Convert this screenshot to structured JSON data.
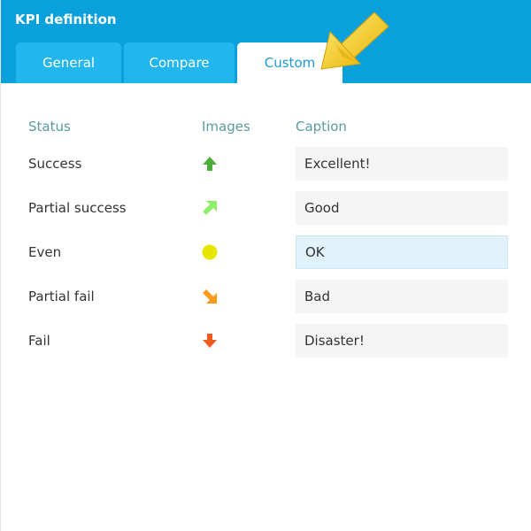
{
  "dialog": {
    "title": "KPI definition"
  },
  "tabs": [
    {
      "label": "General"
    },
    {
      "label": "Compare"
    },
    {
      "label": "Custom"
    }
  ],
  "active_tab": "Custom",
  "columns": {
    "status": "Status",
    "images": "Images",
    "caption": "Caption"
  },
  "rows": [
    {
      "status": "Success",
      "icon": "arrow-up-icon",
      "icon_color": "#4caf3c",
      "caption": "Excellent!"
    },
    {
      "status": "Partial success",
      "icon": "arrow-up-right-icon",
      "icon_color": "#8ef06a",
      "caption": "Good"
    },
    {
      "status": "Even",
      "icon": "circle-icon",
      "icon_color": "#e6e600",
      "caption": "OK"
    },
    {
      "status": "Partial fail",
      "icon": "arrow-down-right-icon",
      "icon_color": "#ff9a1a",
      "caption": "Bad"
    },
    {
      "status": "Fail",
      "icon": "arrow-down-icon",
      "icon_color": "#f05a1e",
      "caption": "Disaster!"
    }
  ],
  "colors": {
    "header": "#0aa0dc",
    "tab": "#22b6ee",
    "active_tab_text": "#1e9bd7",
    "column_header": "#5b9aa0",
    "pointer": "#f5c518"
  }
}
